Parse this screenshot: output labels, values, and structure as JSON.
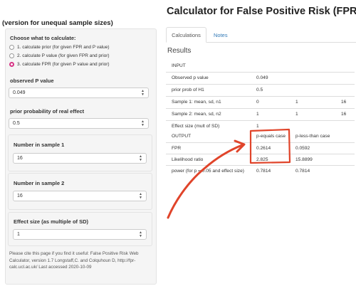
{
  "header": {
    "title": "Calculator for False Positive Risk (FPR)",
    "subtitle": "(version for unequal sample sizes)"
  },
  "sidebar": {
    "choose_label": "Choose what to calculate:",
    "options": [
      "1. calculate prior (for given FPR and P value)",
      "2. calculate P value (for given FPR and prior)",
      "3. calculate FPR (for given P value and prior)"
    ],
    "selected_option": 3,
    "observed_p_label": "observed P value",
    "observed_p_value": "0.049",
    "prior_label": "prior probability of real effect",
    "prior_value": "0.5",
    "n1_label": "Number in sample 1",
    "n1_value": "16",
    "n2_label": "Number in sample 2",
    "n2_value": "16",
    "effect_label": "Effect size (as multiple of SD)",
    "effect_value": "1",
    "citation": "Please cite this page if you find it useful: False Positive Risk Web Calculator, version 1.7 Longstaff,C. and Colquhoun D, http://fpr-calc.ucl.ac.uk/ Last accessed 2020-10-09"
  },
  "tabs": [
    "Calculations",
    "Notes"
  ],
  "results": {
    "heading": "Results",
    "input_label": "INPUT",
    "input_rows": [
      {
        "label": "Observed p value",
        "c1": "0.049",
        "c2": "",
        "c3": ""
      },
      {
        "label": "prior prob of H1",
        "c1": "0.5",
        "c2": "",
        "c3": ""
      },
      {
        "label": "Sample 1: mean, sd, n1",
        "c1": "0",
        "c2": "1",
        "c3": "16"
      },
      {
        "label": "Sample 2: mean, sd, n2",
        "c1": "1",
        "c2": "1",
        "c3": "16"
      },
      {
        "label": "Effect size (mult of SD)",
        "c1": "1",
        "c2": "",
        "c3": ""
      }
    ],
    "output_label": "OUTPUT",
    "output_headers": [
      "p-equals case",
      "p-less-than case"
    ],
    "output_rows": [
      {
        "label": "FPR",
        "c1": "0.2614",
        "c2": "0.0592"
      },
      {
        "label": "Likelihood ratio",
        "c1": "2.825",
        "c2": "15.8899"
      },
      {
        "label": "power (for p = 0.05 and effect size)",
        "c1": "0.7814",
        "c2": "0.7814"
      }
    ]
  },
  "colors": {
    "annotation": "#e0442a",
    "radio_selected": "#d63384",
    "link": "#337ab7"
  }
}
